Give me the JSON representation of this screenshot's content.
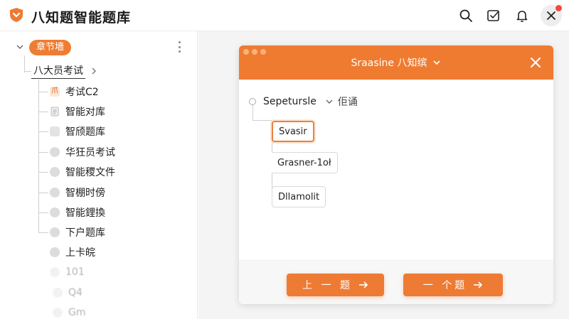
{
  "colors": {
    "accent": "#ee7b34",
    "close_dot": "#f04a3e"
  },
  "header": {
    "title": "八知题智能题库",
    "icons": [
      "logo-shield-icon",
      "search-icon",
      "checkbox-icon",
      "bell-icon",
      "close-icon"
    ]
  },
  "sidebar": {
    "chapter_badge": "章节墻",
    "level1": {
      "label": "八大员考试"
    },
    "items": [
      {
        "label": "考试C2",
        "icon": "file-icon",
        "active": true,
        "active_icon_text": "爪"
      },
      {
        "label": "智能对库",
        "icon": "document-icon"
      },
      {
        "label": "智颀题库",
        "icon": "square-icon"
      },
      {
        "label": "华狂员考试",
        "icon": "dot-icon"
      },
      {
        "label": "智能稷文件",
        "icon": "dot-icon"
      },
      {
        "label": "智棚时傍",
        "icon": "dot-icon"
      },
      {
        "label": "智能鋰換",
        "icon": "dot-icon"
      },
      {
        "label": "下户题库",
        "icon": "dot-icon"
      },
      {
        "label": "上卡皖",
        "icon": "dot-icon"
      },
      {
        "label": "101",
        "icon": "dot-icon"
      },
      {
        "label": "Q4",
        "icon": "dot-icon"
      },
      {
        "label": "Gm",
        "icon": "dot-icon"
      }
    ]
  },
  "dialog": {
    "title": "Sraasine 八知缤",
    "root_node": {
      "label": "Sepetursle",
      "suffix": "佢诵"
    },
    "options": [
      {
        "label": "Svasir",
        "selected": true
      },
      {
        "label": "Grasner-1oł",
        "selected": false
      },
      {
        "label": "Dllamolit",
        "selected": false
      }
    ],
    "prev_button": "上 一 题",
    "next_button": "一 个题"
  }
}
